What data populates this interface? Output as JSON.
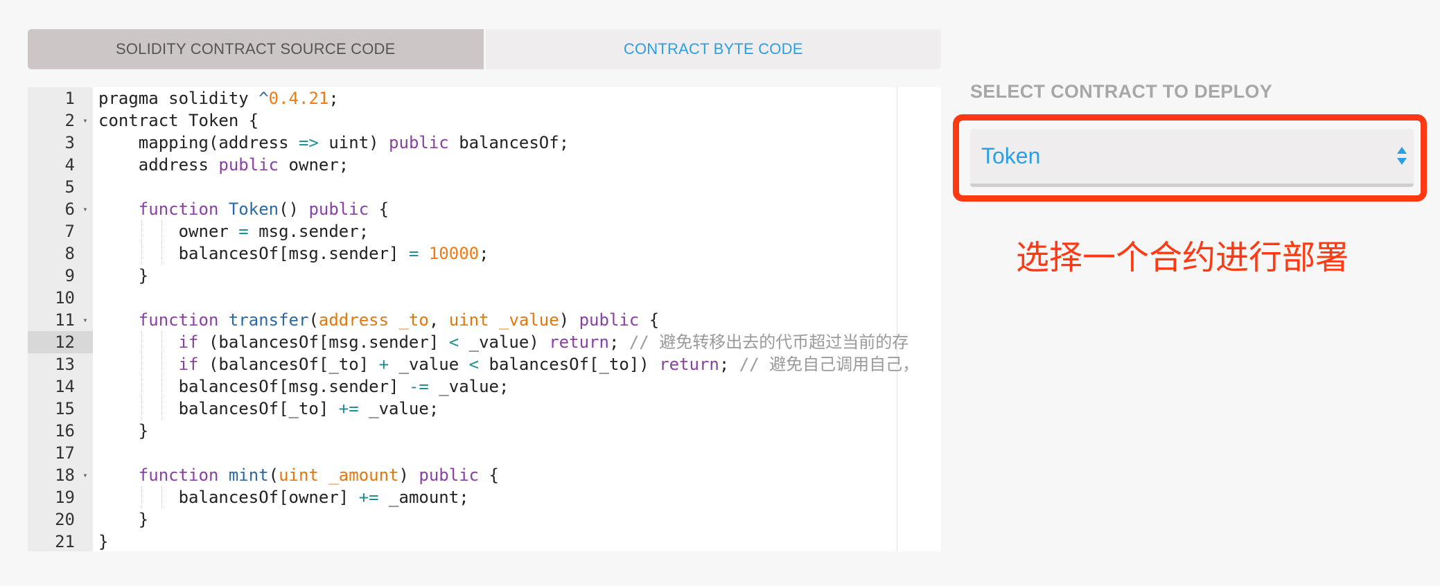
{
  "tabs": {
    "source": "SOLIDITY CONTRACT SOURCE CODE",
    "bytecode": "CONTRACT BYTE CODE"
  },
  "editor": {
    "active_line": 12,
    "lines": [
      {
        "n": "1",
        "fold": false,
        "indent": 0,
        "tokens": [
          [
            "pragma solidity ",
            "plain"
          ],
          [
            "^",
            "fn"
          ],
          [
            "0.4.21",
            "num"
          ],
          [
            ";",
            "plain"
          ]
        ]
      },
      {
        "n": "2",
        "fold": true,
        "indent": 0,
        "tokens": [
          [
            "contract Token {",
            "plain"
          ]
        ]
      },
      {
        "n": "3",
        "fold": false,
        "indent": 1,
        "tokens": [
          [
            "    mapping(address ",
            "plain"
          ],
          [
            "=>",
            "op"
          ],
          [
            " uint) ",
            "plain"
          ],
          [
            "public",
            "kw"
          ],
          [
            " balancesOf;",
            "plain"
          ]
        ]
      },
      {
        "n": "4",
        "fold": false,
        "indent": 1,
        "tokens": [
          [
            "    address ",
            "plain"
          ],
          [
            "public",
            "kw"
          ],
          [
            " owner;",
            "plain"
          ]
        ]
      },
      {
        "n": "5",
        "fold": false,
        "indent": 0,
        "tokens": [
          [
            "",
            "plain"
          ]
        ]
      },
      {
        "n": "6",
        "fold": true,
        "indent": 1,
        "tokens": [
          [
            "    ",
            "plain"
          ],
          [
            "function",
            "kw"
          ],
          [
            " ",
            "plain"
          ],
          [
            "Token",
            "fn"
          ],
          [
            "() ",
            "plain"
          ],
          [
            "public",
            "kw"
          ],
          [
            " {",
            "plain"
          ]
        ]
      },
      {
        "n": "7",
        "fold": false,
        "indent": 2,
        "tokens": [
          [
            "        owner ",
            "plain"
          ],
          [
            "=",
            "op"
          ],
          [
            " msg.sender;",
            "plain"
          ]
        ]
      },
      {
        "n": "8",
        "fold": false,
        "indent": 2,
        "tokens": [
          [
            "        balancesOf[msg.sender] ",
            "plain"
          ],
          [
            "=",
            "op"
          ],
          [
            " ",
            "plain"
          ],
          [
            "10000",
            "num"
          ],
          [
            ";",
            "plain"
          ]
        ]
      },
      {
        "n": "9",
        "fold": false,
        "indent": 1,
        "tokens": [
          [
            "    }",
            "plain"
          ]
        ]
      },
      {
        "n": "10",
        "fold": false,
        "indent": 0,
        "tokens": [
          [
            "",
            "plain"
          ]
        ]
      },
      {
        "n": "11",
        "fold": true,
        "indent": 1,
        "tokens": [
          [
            "    ",
            "plain"
          ],
          [
            "function",
            "kw"
          ],
          [
            " ",
            "plain"
          ],
          [
            "transfer",
            "fn"
          ],
          [
            "(",
            "plain"
          ],
          [
            "address _to",
            "param"
          ],
          [
            ", ",
            "plain"
          ],
          [
            "uint _value",
            "param"
          ],
          [
            ") ",
            "plain"
          ],
          [
            "public",
            "kw"
          ],
          [
            " {",
            "plain"
          ]
        ]
      },
      {
        "n": "12",
        "fold": false,
        "indent": 2,
        "tokens": [
          [
            "        ",
            "plain"
          ],
          [
            "if",
            "kw"
          ],
          [
            " (balancesOf[msg.sender] ",
            "plain"
          ],
          [
            "<",
            "op"
          ],
          [
            " _value) ",
            "plain"
          ],
          [
            "return",
            "kw"
          ],
          [
            "; ",
            "plain"
          ],
          [
            "// 避免转移出去的代币超过当前的存",
            "cmt"
          ]
        ]
      },
      {
        "n": "13",
        "fold": false,
        "indent": 2,
        "tokens": [
          [
            "        ",
            "plain"
          ],
          [
            "if",
            "kw"
          ],
          [
            " (balancesOf[_to] ",
            "plain"
          ],
          [
            "+",
            "op"
          ],
          [
            " _value ",
            "plain"
          ],
          [
            "<",
            "op"
          ],
          [
            " balancesOf[_to]) ",
            "plain"
          ],
          [
            "return",
            "kw"
          ],
          [
            "; ",
            "plain"
          ],
          [
            "// 避免自己调用自己，",
            "cmt"
          ]
        ]
      },
      {
        "n": "14",
        "fold": false,
        "indent": 2,
        "tokens": [
          [
            "        balancesOf[msg.sender] ",
            "plain"
          ],
          [
            "-=",
            "op"
          ],
          [
            " _value;",
            "plain"
          ]
        ]
      },
      {
        "n": "15",
        "fold": false,
        "indent": 2,
        "tokens": [
          [
            "        balancesOf[_to] ",
            "plain"
          ],
          [
            "+=",
            "op"
          ],
          [
            " _value;",
            "plain"
          ]
        ]
      },
      {
        "n": "16",
        "fold": false,
        "indent": 1,
        "tokens": [
          [
            "    }",
            "plain"
          ]
        ]
      },
      {
        "n": "17",
        "fold": false,
        "indent": 0,
        "tokens": [
          [
            "",
            "plain"
          ]
        ]
      },
      {
        "n": "18",
        "fold": true,
        "indent": 1,
        "tokens": [
          [
            "    ",
            "plain"
          ],
          [
            "function",
            "kw"
          ],
          [
            " ",
            "plain"
          ],
          [
            "mint",
            "fn"
          ],
          [
            "(",
            "plain"
          ],
          [
            "uint _amount",
            "param"
          ],
          [
            ") ",
            "plain"
          ],
          [
            "public",
            "kw"
          ],
          [
            " {",
            "plain"
          ]
        ]
      },
      {
        "n": "19",
        "fold": false,
        "indent": 2,
        "tokens": [
          [
            "        balancesOf[owner] ",
            "plain"
          ],
          [
            "+=",
            "op"
          ],
          [
            " _amount;",
            "plain"
          ]
        ]
      },
      {
        "n": "20",
        "fold": false,
        "indent": 1,
        "tokens": [
          [
            "    }",
            "plain"
          ]
        ]
      },
      {
        "n": "21",
        "fold": false,
        "indent": 0,
        "tokens": [
          [
            "}",
            "plain"
          ]
        ]
      }
    ]
  },
  "deploy": {
    "label": "SELECT CONTRACT TO DEPLOY",
    "selected": "Token",
    "annotation": "选择一个合约进行部署",
    "annotation_color": "#ff3a13",
    "accent": "#2a9fe3"
  }
}
